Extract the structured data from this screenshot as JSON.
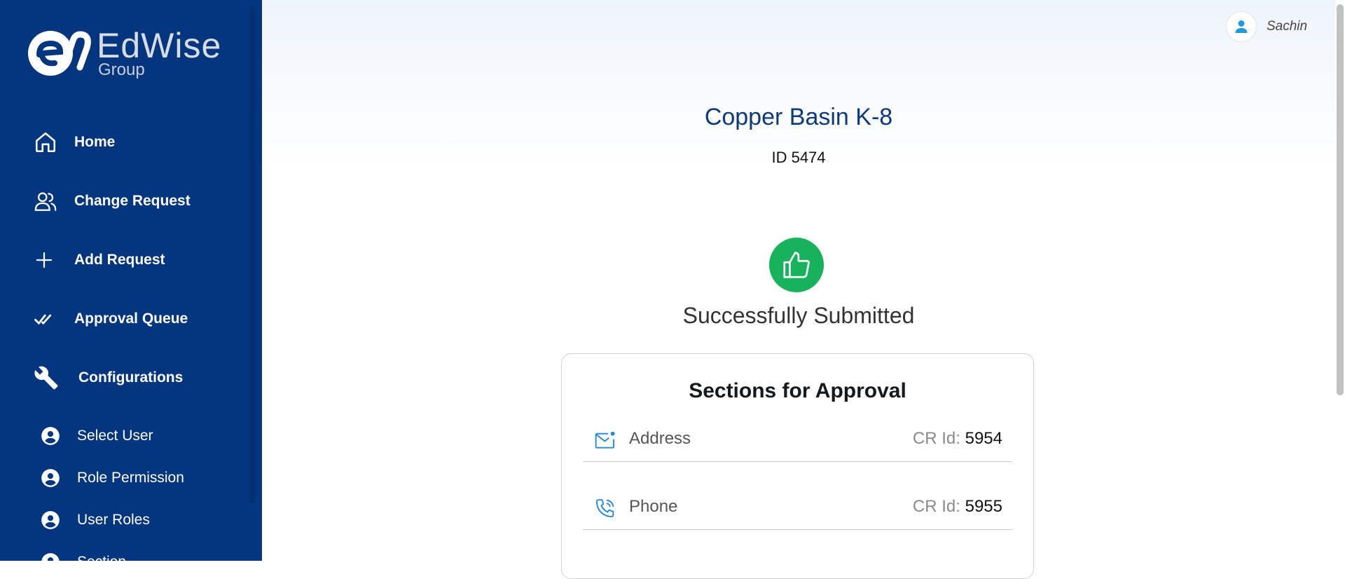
{
  "brand": {
    "word": "EdWise",
    "sub": "Group"
  },
  "sidebar": {
    "items": [
      {
        "label": "Home",
        "icon": "home-icon"
      },
      {
        "label": "Change Request",
        "icon": "users-icon"
      },
      {
        "label": "Add Request",
        "icon": "plus-icon"
      },
      {
        "label": "Approval Queue",
        "icon": "double-check-icon"
      },
      {
        "label": "Configurations",
        "icon": "wrench-icon"
      }
    ],
    "sub_items": [
      {
        "label": "Select User",
        "icon": "account-circle-icon"
      },
      {
        "label": "Role Permission",
        "icon": "account-circle-icon"
      },
      {
        "label": "User Roles",
        "icon": "account-circle-icon"
      },
      {
        "label": "Section",
        "icon": "account-circle-icon"
      }
    ]
  },
  "header": {
    "user_name": "Sachin"
  },
  "main": {
    "school_name": "Copper Basin K-8",
    "school_id": "ID 5474",
    "status_text": "Successfully Submitted"
  },
  "approval_card": {
    "title": "Sections for Approval",
    "cr_label": "CR Id:",
    "rows": [
      {
        "section": "Address",
        "cr_id": "5954",
        "icon": "mail-icon"
      },
      {
        "section": "Phone",
        "cr_id": "5955",
        "icon": "phone-icon"
      }
    ]
  },
  "colors": {
    "sidebar_bg": "#04357f",
    "title": "#0d3a7d",
    "success": "#17b35c",
    "icon_accent": "#1e88e5"
  }
}
